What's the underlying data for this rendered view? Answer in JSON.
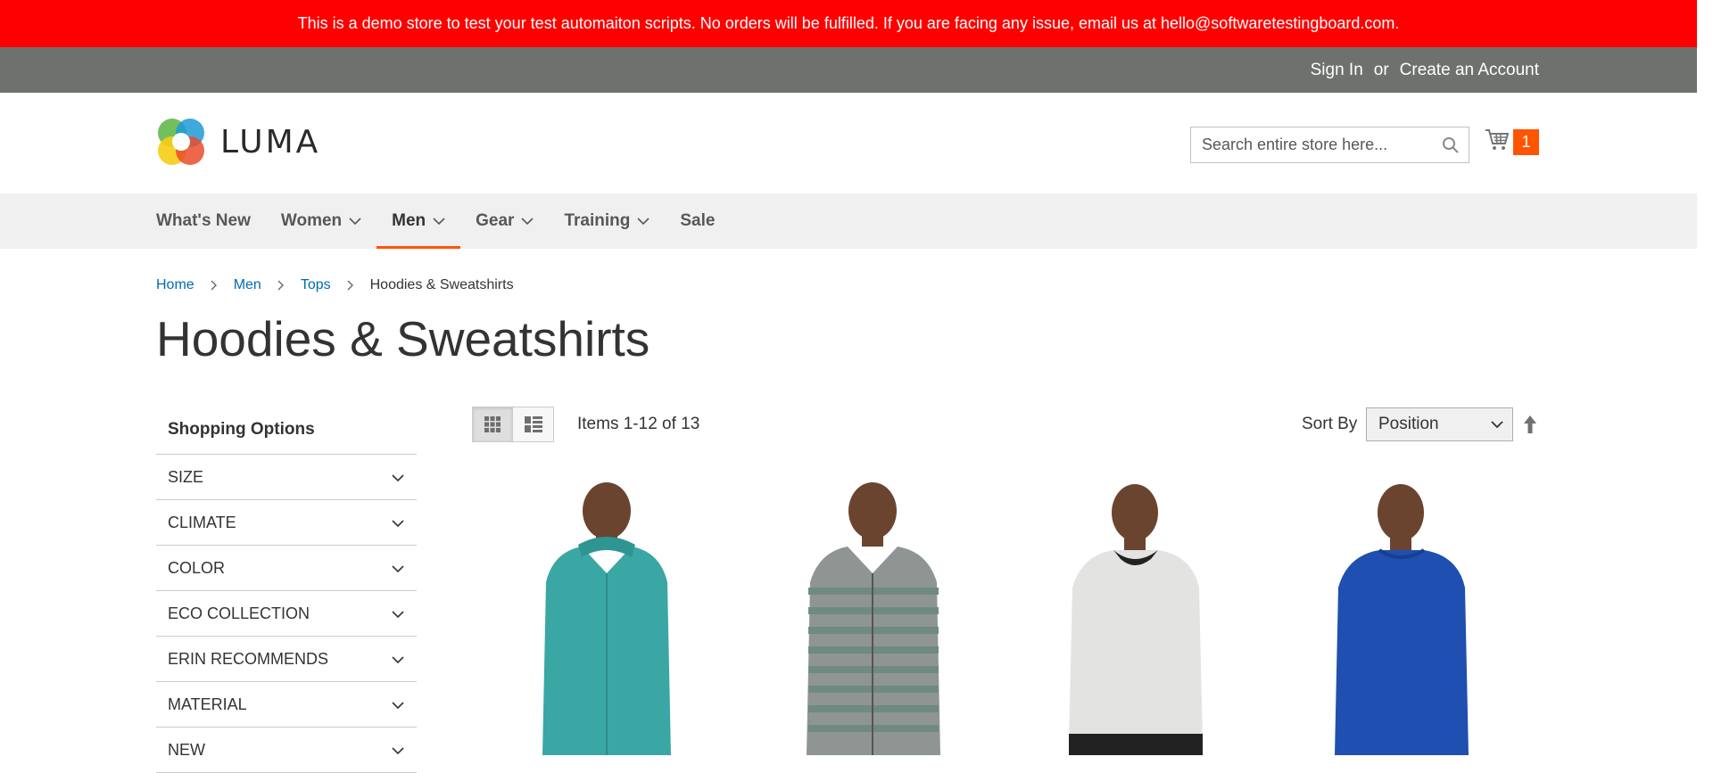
{
  "demo_notice": "This is a demo store to test your test automaiton scripts. No orders will be fulfilled. If you are facing any issue, email us at hello@softwaretestingboard.com.",
  "header_links": {
    "sign_in": "Sign In",
    "or": "or",
    "create_account": "Create an Account"
  },
  "logo": {
    "text": "LUMA"
  },
  "search": {
    "placeholder": "Search entire store here..."
  },
  "cart": {
    "count": "1"
  },
  "nav": {
    "items": [
      {
        "label": "What's New",
        "dropdown": false,
        "active": false
      },
      {
        "label": "Women",
        "dropdown": true,
        "active": false
      },
      {
        "label": "Men",
        "dropdown": true,
        "active": true
      },
      {
        "label": "Gear",
        "dropdown": true,
        "active": false
      },
      {
        "label": "Training",
        "dropdown": true,
        "active": false
      },
      {
        "label": "Sale",
        "dropdown": false,
        "active": false
      }
    ]
  },
  "breadcrumb": {
    "items": [
      "Home",
      "Men",
      "Tops"
    ],
    "current": "Hoodies & Sweatshirts"
  },
  "page_title": "Hoodies & Sweatshirts",
  "sidebar": {
    "title": "Shopping Options",
    "filters": [
      "SIZE",
      "CLIMATE",
      "COLOR",
      "ECO COLLECTION",
      "ERIN RECOMMENDS",
      "MATERIAL",
      "NEW"
    ]
  },
  "toolbar": {
    "amount": "Items 1-12 of 13",
    "sort_label": "Sort By",
    "sort_value": "Position"
  },
  "colors": {
    "demo_bar": "#ff0000",
    "top_bar": "#6e716e",
    "accent": "#ff5501",
    "link": "#006bb4"
  },
  "products": [
    {
      "garment": "teal zip hoodie"
    },
    {
      "garment": "grey striped hoodie"
    },
    {
      "garment": "light grey sweatshirt"
    },
    {
      "garment": "blue long sleeve"
    }
  ]
}
